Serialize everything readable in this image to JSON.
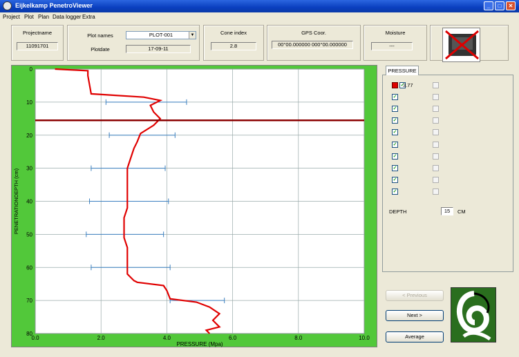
{
  "window": {
    "title": "Eijkelkamp PenetroViewer"
  },
  "menu": [
    "Project",
    "Plot",
    "Plan",
    "Data logger",
    "Extra"
  ],
  "header": {
    "project_name_label": "Projectname",
    "project_name_value": "11091701",
    "plot_names_label": "Plot names",
    "plot_select_value": "PLOT-001",
    "plotdate_label": "Plotdate",
    "plotdate_value": "17-09-11",
    "cone_index_label": "Cone index",
    "cone_index_value": "2.8",
    "gps_label": "GPS Coor.",
    "gps_value": "00°00.000000 000°00.000000",
    "moisture_label": "Moisture",
    "moisture_value": "---"
  },
  "side": {
    "tab_label": "PRESSURE",
    "first_value": "3.77",
    "checkboxes_left": [
      true,
      true,
      true,
      true,
      true,
      true,
      true,
      true,
      true,
      true
    ],
    "checkboxes_right": [
      false,
      false,
      false,
      false,
      false,
      false,
      false,
      false,
      false,
      false
    ],
    "depth_label": "DEPTH",
    "depth_value": "15",
    "depth_unit": "CM",
    "previous_label": "< Previous",
    "next_label": "Next >",
    "average_label": "Average"
  },
  "colors": {
    "series": "#e00000",
    "marker": "#8b0000",
    "errorbar": "#3a7fc0",
    "background": "#52c83a"
  },
  "chart_data": {
    "type": "line",
    "xlabel": "PRESSURE (Mpa)",
    "ylabel": "PENETRATIONDEPTH (cm)",
    "xlim": [
      0,
      10
    ],
    "ylim": [
      0,
      80
    ],
    "xticks": [
      "0.0",
      "2.0",
      "4.0",
      "6.0",
      "8.0",
      "10.0"
    ],
    "yticks": [
      "0",
      "10",
      "20",
      "30",
      "40",
      "50",
      "60",
      "70",
      "80"
    ],
    "depth_marker": 15.5,
    "series": [
      {
        "x": [
          0.6,
          1.6,
          1.6,
          1.7,
          3.3,
          3.8,
          3.5,
          3.6,
          3.8,
          3.6,
          3.2,
          3.1,
          3.0,
          2.9,
          2.8,
          2.8,
          2.8,
          2.8,
          2.8,
          2.7,
          2.7,
          2.7,
          2.8,
          2.8,
          2.8,
          2.8,
          2.9,
          3.0,
          3.1,
          3.9,
          4.0,
          4.1,
          4.9,
          5.3,
          5.6,
          5.4,
          5.6,
          5.2,
          5.3
        ],
        "y": [
          0,
          0.5,
          2,
          7.5,
          8.5,
          9.5,
          11,
          13,
          15,
          17,
          19.5,
          22,
          24,
          27,
          30,
          33,
          36,
          39,
          42,
          45,
          48,
          51,
          54,
          57,
          60,
          62,
          63,
          64,
          64.5,
          65.5,
          67,
          69.5,
          70.5,
          72,
          74,
          76,
          78,
          79,
          80
        ]
      }
    ],
    "error_bars": [
      {
        "y": 10,
        "low": 2.15,
        "high": 4.6
      },
      {
        "y": 20,
        "low": 2.25,
        "high": 4.25
      },
      {
        "y": 30,
        "low": 1.7,
        "high": 3.95
      },
      {
        "y": 40,
        "low": 1.65,
        "high": 4.05
      },
      {
        "y": 50,
        "low": 1.55,
        "high": 3.9
      },
      {
        "y": 60,
        "low": 1.7,
        "high": 4.1
      },
      {
        "y": 70,
        "low": 4.1,
        "high": 5.75
      }
    ]
  }
}
